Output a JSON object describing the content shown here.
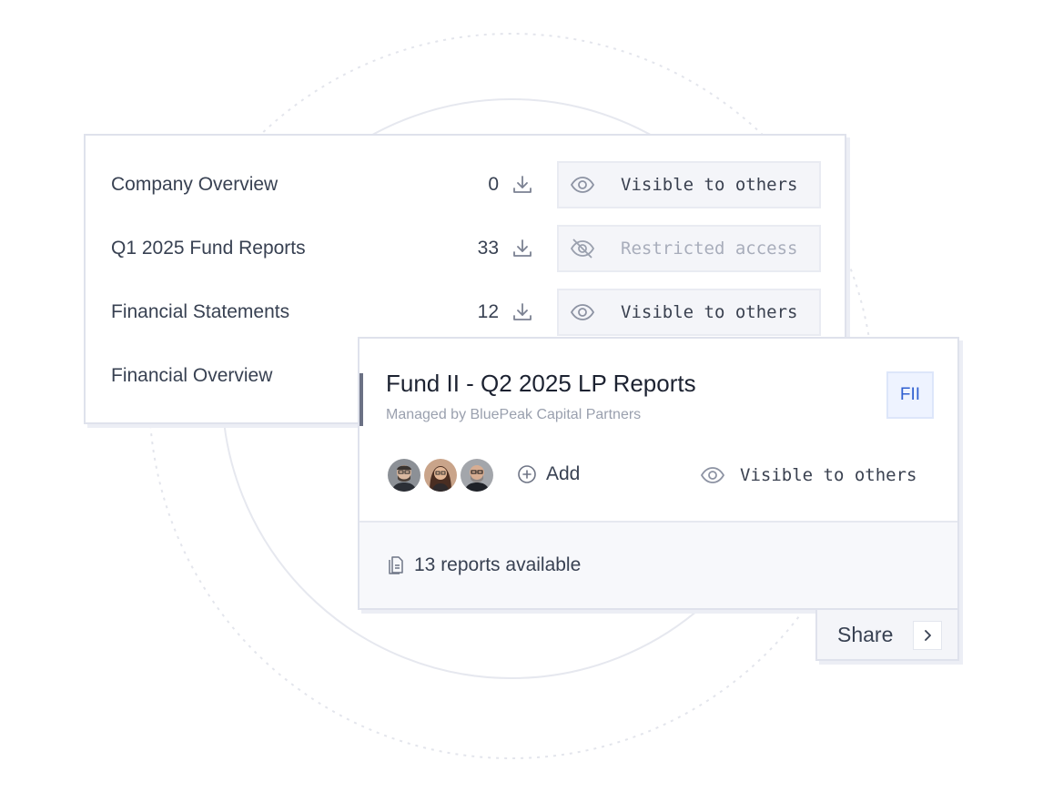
{
  "folders": [
    {
      "name": "Company Overview",
      "count": "0",
      "visibility": "Visible to others",
      "restricted": false
    },
    {
      "name": "Q1 2025 Fund Reports",
      "count": "33",
      "visibility": "Restricted access",
      "restricted": true
    },
    {
      "name": "Financial Statements",
      "count": "12",
      "visibility": "Visible to others",
      "restricted": false
    },
    {
      "name": "Financial Overview"
    }
  ],
  "fund": {
    "title": "Fund II - Q2 2025 LP Reports",
    "subtitle": "Managed by BluePeak Capital Partners",
    "badge": "FII",
    "add_label": "Add",
    "visibility": "Visible to others",
    "reports": "13 reports available"
  },
  "share": {
    "label": "Share"
  },
  "colors": {
    "accent_blue": "#2f5fd0",
    "border": "#dfe2ec",
    "text": "#384152",
    "muted": "#a8adbb"
  },
  "icons": [
    "download-icon",
    "eye-icon",
    "eye-off-icon",
    "plus-circle-icon",
    "document-icon",
    "chevron-right-icon"
  ]
}
